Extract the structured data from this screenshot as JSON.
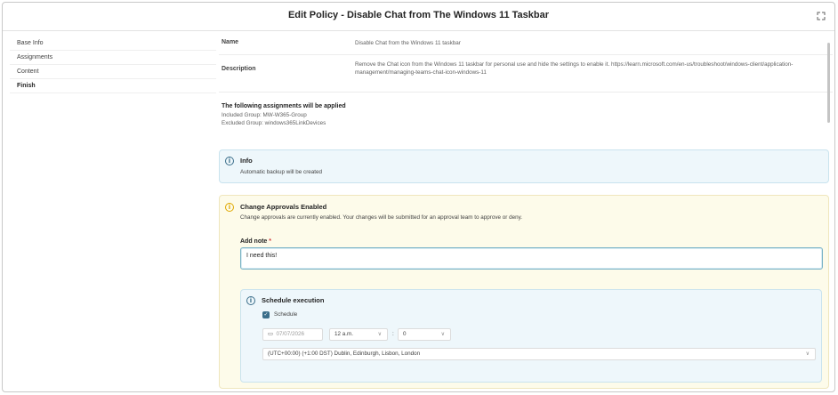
{
  "dialog": {
    "title": "Edit Policy - Disable Chat from The Windows 11 Taskbar",
    "expand_icon": "expand-icon"
  },
  "sidebar": {
    "items": [
      {
        "label": "Base Info",
        "active": false
      },
      {
        "label": "Assignments",
        "active": false
      },
      {
        "label": "Content",
        "active": false
      },
      {
        "label": "Finish",
        "active": true
      }
    ]
  },
  "summary": {
    "name_label": "Name",
    "name_value": "Disable Chat from the Windows 11 taskbar",
    "description_label": "Description",
    "description_value": "Remove the Chat icon from the Windows 11 taskbar for personal use and hide the settings to enable it. https://learn.microsoft.com/en-us/troubleshoot/windows-client/application-management/managing-teams-chat-icon-windows-11",
    "assignments_heading": "The following assignments will be applied",
    "included": "Included Group: MW-W365-Group",
    "excluded": "Excluded Group: windows365LinkDevices"
  },
  "info": {
    "icon": "info-icon",
    "title": "Info",
    "text": "Automatic backup will be created"
  },
  "approval": {
    "icon": "warning-info-icon",
    "title": "Change Approvals Enabled",
    "text": "Change approvals are currently enabled. Your changes will be submitted for an approval team to approve or deny.",
    "note_label": "Add note",
    "required_mark": "*",
    "note_value": "I need this!"
  },
  "schedule": {
    "icon": "info-icon",
    "title": "Schedule execution",
    "checkbox_label": "Schedule",
    "checked": true,
    "date": "07/07/2026",
    "hour": "12 a.m.",
    "separator": ":",
    "minute": "0",
    "timezone": "(UTC+00:00) (+1:00 DST) Dublin, Edinburgh, Lisbon, London"
  },
  "colors": {
    "info_bg": "#eef7fb",
    "approval_bg": "#fdfbea",
    "accent": "#3a6e8a",
    "warning": "#e0a800",
    "required": "#d13438"
  }
}
